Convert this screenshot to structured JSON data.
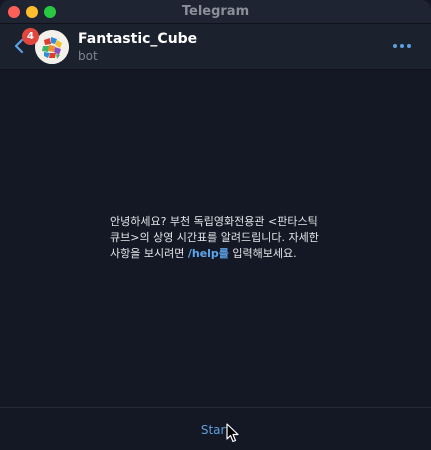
{
  "window": {
    "title": "Telegram"
  },
  "header": {
    "unread_count": "4",
    "chat_title": "Fantastic_Cube",
    "chat_subtitle": "bot"
  },
  "chat": {
    "description_part1": "안녕하세요? 부천 독립영화전용관 <판타스틱 큐브>의 상영 시간표를 알려드립니다. 자세한 사항을 보시려면 ",
    "description_command": "/help를",
    "description_part2": " 입력해보세요."
  },
  "bottom": {
    "start_label": "Start"
  },
  "colors": {
    "accent": "#5d9fe0",
    "badge": "#e0473f",
    "background": "#141824",
    "header": "#1c212e"
  },
  "icons": [
    "close-icon",
    "minimize-icon",
    "zoom-icon",
    "back-icon",
    "more-icon",
    "pointer-cursor-icon"
  ]
}
